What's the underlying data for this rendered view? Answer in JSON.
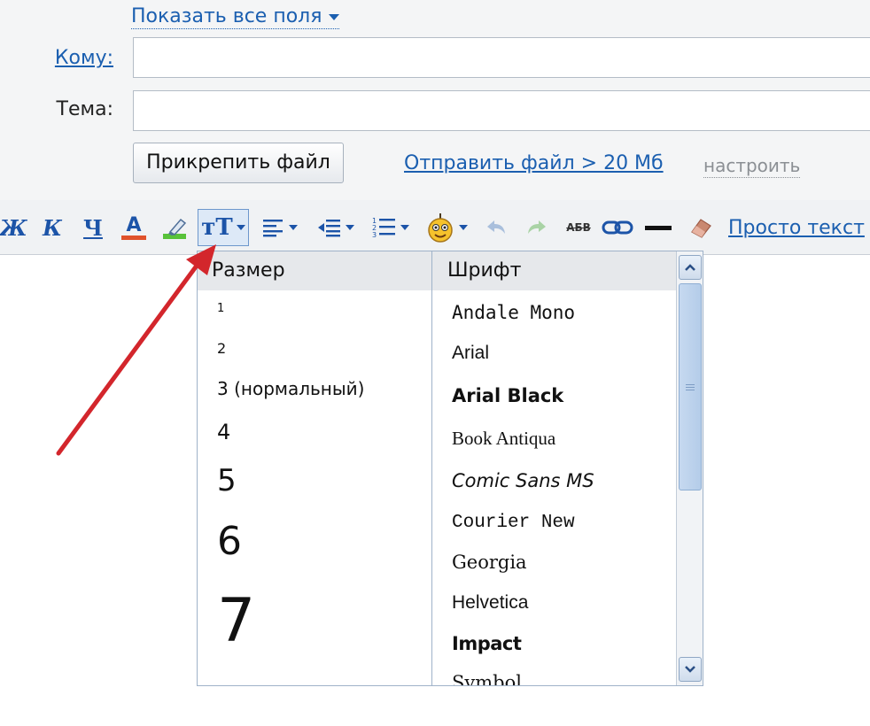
{
  "compose": {
    "show_fields": "Показать все поля",
    "to_label": "Кому:",
    "subject_label": "Тема:",
    "to_value": "",
    "subject_value": "",
    "attach_button": "Прикрепить файл",
    "send_large_link": "Отправить файл > 20 Мб",
    "setup_link": "настроить"
  },
  "toolbar": {
    "bold": "Ж",
    "italic": "К",
    "underline": "Ч",
    "text_color": "А",
    "font_button": "тТ",
    "strike": "АБВ",
    "plain_text_link": "Просто текст"
  },
  "dropdown": {
    "size_header": "Размер",
    "font_header": "Шрифт",
    "sizes": [
      "1",
      "2",
      "3 (нормальный)",
      "4",
      "5",
      "6",
      "7"
    ],
    "fonts": [
      "Andale Mono",
      "Arial",
      "Arial Black",
      "Book Antiqua",
      "Comic Sans MS",
      "Courier New",
      "Georgia",
      "Helvetica",
      "Impact",
      "Symbol"
    ]
  },
  "colors": {
    "link": "#1b5fb0",
    "arrow": "#d3262c",
    "toolbar_bg": "#f0f2f4"
  }
}
